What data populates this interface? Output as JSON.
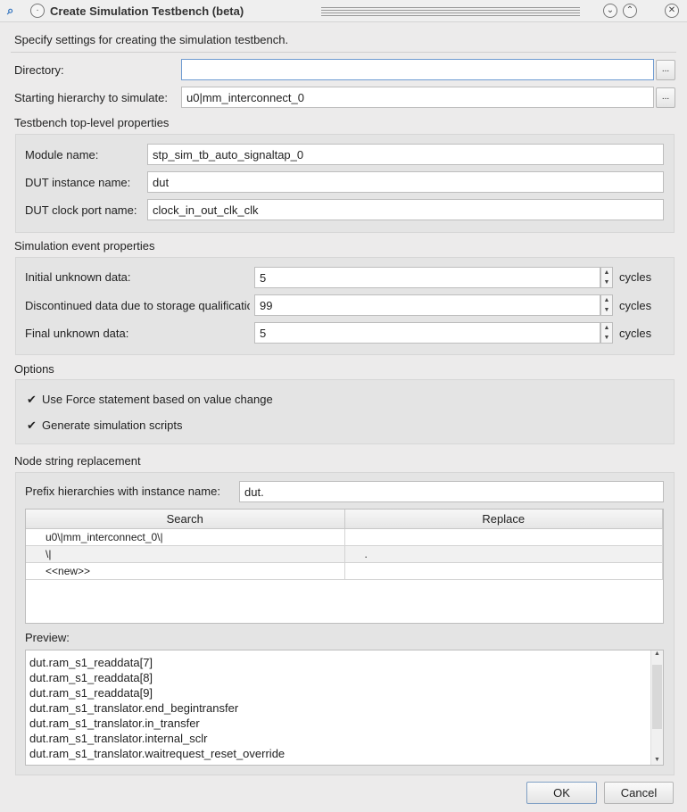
{
  "window": {
    "title": "Create Simulation Testbench (beta)"
  },
  "description": "Specify settings for creating the simulation testbench.",
  "directory": {
    "label": "Directory:",
    "value": "",
    "browse": "..."
  },
  "hierarchy": {
    "label": "Starting hierarchy to simulate:",
    "value": "u0|mm_interconnect_0",
    "browse": "..."
  },
  "testbench": {
    "heading": "Testbench top-level properties",
    "module_label": "Module name:",
    "module_value": "stp_sim_tb_auto_signaltap_0",
    "dut_label": "DUT instance name:",
    "dut_value": "dut",
    "clock_label": "DUT clock port name:",
    "clock_value": "clock_in_out_clk_clk"
  },
  "simulation": {
    "heading": "Simulation event properties",
    "unit": "cycles",
    "rows": [
      {
        "label": "Initial unknown data:",
        "value": "5"
      },
      {
        "label": "Discontinued data due to storage qualification:",
        "value": "99"
      },
      {
        "label": "Final unknown data:",
        "value": "5"
      }
    ]
  },
  "options": {
    "heading": "Options",
    "items": [
      {
        "label": "Use Force statement based on value change",
        "checked": true
      },
      {
        "label": "Generate simulation scripts",
        "checked": true
      }
    ]
  },
  "node": {
    "heading": "Node string replacement",
    "prefix_label": "Prefix hierarchies with instance name:",
    "prefix_value": "dut.",
    "columns": [
      "Search",
      "Replace"
    ],
    "rows": [
      [
        "u0\\|mm_interconnect_0\\|",
        ""
      ],
      [
        "\\|",
        "."
      ],
      [
        "<<new>>",
        ""
      ]
    ],
    "preview_label": "Preview:",
    "preview": [
      "dut.ram_s1_readdata[7]",
      "dut.ram_s1_readdata[8]",
      "dut.ram_s1_readdata[9]",
      "dut.ram_s1_translator.end_begintransfer",
      "dut.ram_s1_translator.in_transfer",
      "dut.ram_s1_translator.internal_sclr",
      "dut.ram_s1_translator.waitrequest_reset_override"
    ]
  },
  "buttons": {
    "ok": "OK",
    "cancel": "Cancel"
  }
}
